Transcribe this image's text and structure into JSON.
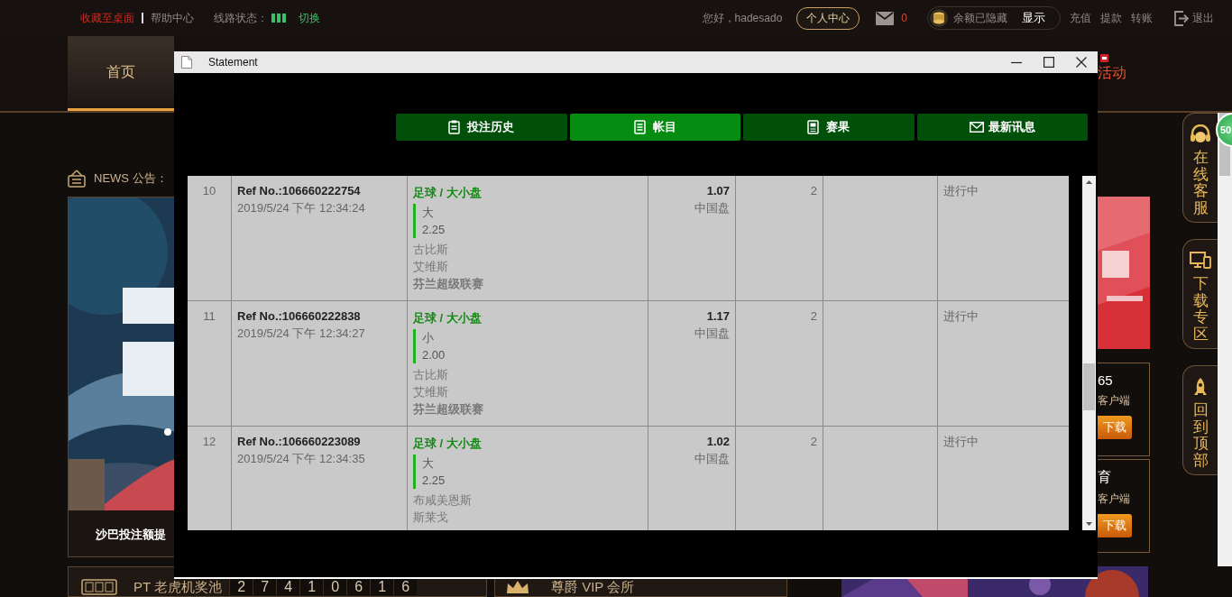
{
  "top_bar": {
    "links": [
      {
        "text": "收藏至桌面",
        "kind": "highlight"
      },
      {
        "text": "帮助中心",
        "kind": "plain"
      }
    ],
    "line_status_label": "线路状态：",
    "line_switch": "切换",
    "greeting": "您好，hadesado",
    "member_center": "个人中心",
    "messages": "0",
    "balance_hidden": "余额已隐藏",
    "show": "显示",
    "actions": [
      "充值",
      "提款",
      "转账"
    ],
    "logout": "退出"
  },
  "nav": {
    "items": [
      {
        "label": "首页",
        "selected": true
      },
      {
        "label": "活动",
        "selected": false
      }
    ]
  },
  "news_label": "NEWS 公告：",
  "promo_caption": "沙巴投注额提",
  "right_promos": [
    {
      "title": "65",
      "subtitle": "客户端",
      "button": "下载"
    },
    {
      "title": "育",
      "subtitle": "客户端",
      "button": "下载"
    }
  ],
  "side_buttons": [
    {
      "label": "在线客服",
      "kind": "headset"
    },
    {
      "label": "下载专区",
      "kind": "devices"
    },
    {
      "label": "回到顶部",
      "kind": "rocket"
    }
  ],
  "float_badge": "50",
  "jackpot": {
    "label": "PT 老虎机奖池",
    "digits": [
      "2",
      "7",
      "4",
      "1",
      "0",
      "6",
      "1",
      "6"
    ]
  },
  "vip": "尊爵 VIP 会所",
  "dialog": {
    "title": "Statement",
    "tabs": [
      {
        "label": "投注历史",
        "kind": "history",
        "selected": false
      },
      {
        "label": "帐目",
        "kind": "ledger",
        "selected": true
      },
      {
        "label": "赛果",
        "kind": "results",
        "selected": false
      },
      {
        "label": "最新讯息",
        "kind": "mail",
        "selected": false
      }
    ],
    "rows": [
      {
        "index": "10",
        "ref": "Ref No.:106660222754",
        "time": "2019/5/24 下午 12:34:24",
        "sport": "足球 / 大小盘",
        "pick": "大",
        "line": "2.25",
        "teams": [
          "古比斯",
          "艾维斯"
        ],
        "league": "芬兰超级联赛",
        "odds": "1.07",
        "odds_type": "中国盘",
        "stake": "2",
        "status": "进行中"
      },
      {
        "index": "11",
        "ref": "Ref No.:106660222838",
        "time": "2019/5/24 下午 12:34:27",
        "sport": "足球 / 大小盘",
        "pick": "小",
        "line": "2.00",
        "teams": [
          "古比斯",
          "艾维斯"
        ],
        "league": "芬兰超级联赛",
        "odds": "1.17",
        "odds_type": "中国盘",
        "stake": "2",
        "status": "进行中"
      },
      {
        "index": "12",
        "ref": "Ref No.:106660223089",
        "time": "2019/5/24 下午 12:34:35",
        "sport": "足球 / 大小盘",
        "pick": "大",
        "line": "2.25",
        "teams": [
          "布咸美恩斯",
          "斯莱戈"
        ],
        "odds": "1.02",
        "odds_type": "中国盘",
        "stake": "2",
        "status": "进行中"
      }
    ]
  }
}
